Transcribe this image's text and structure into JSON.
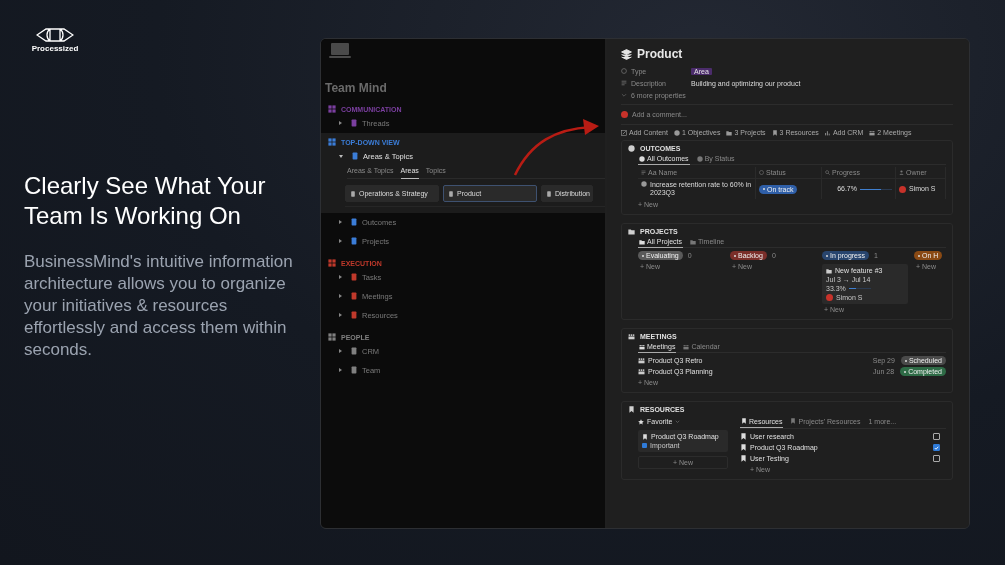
{
  "brand": {
    "name": "Processized"
  },
  "hero": {
    "heading": "Clearly See What Your Team Is Working On",
    "body": "BusinessMind's intuitive information architecture allows you to organize your initiatives & resources effortlessly and access them within seconds."
  },
  "sidebar": {
    "title": "Team Mind",
    "sections": [
      {
        "label": "COMMUNICATION",
        "color": "#7b3fa0",
        "highlighted": false,
        "items": [
          {
            "label": "Threads",
            "expanded": false,
            "highlighted": false
          }
        ]
      },
      {
        "label": "TOP-DOWN VIEW",
        "color": "#3b7dd8",
        "highlighted": true,
        "items": [
          {
            "label": "Areas & Topics",
            "expanded": true,
            "highlighted": true,
            "tabs": [
              {
                "label": "Areas & Topics",
                "selected": false
              },
              {
                "label": "Areas",
                "selected": true
              },
              {
                "label": "Topics",
                "selected": false
              }
            ],
            "cards": [
              {
                "label": "Operations & Strategy",
                "selected": false
              },
              {
                "label": "Product",
                "selected": true
              },
              {
                "label": "Distribution",
                "selected": false
              }
            ]
          },
          {
            "label": "Outcomes",
            "expanded": false,
            "highlighted": false
          },
          {
            "label": "Projects",
            "expanded": false,
            "highlighted": false
          }
        ]
      },
      {
        "label": "EXECUTION",
        "color": "#c0392b",
        "highlighted": false,
        "items": [
          {
            "label": "Tasks",
            "expanded": false,
            "highlighted": false
          },
          {
            "label": "Meetings",
            "expanded": false,
            "highlighted": false
          },
          {
            "label": "Resources",
            "expanded": false,
            "highlighted": false
          }
        ]
      },
      {
        "label": "PEOPLE",
        "color": "#808080",
        "highlighted": false,
        "items": [
          {
            "label": "CRM",
            "expanded": false,
            "highlighted": false
          },
          {
            "label": "Team",
            "expanded": false,
            "highlighted": false
          }
        ]
      }
    ]
  },
  "page": {
    "title": "Product",
    "properties": [
      {
        "label": "Type",
        "value": "Area",
        "kind": "tag"
      },
      {
        "label": "Description",
        "value": "Building and optimizing our product",
        "kind": "text"
      }
    ],
    "more_properties": "6 more properties",
    "comment_placeholder": "Add a comment...",
    "links": [
      "Add Content",
      "1 Objectives",
      "3 Projects",
      "3 Resources",
      "Add CRM",
      "2 Meetings"
    ],
    "outcomes": {
      "title": "OUTCOMES",
      "tabs": [
        {
          "label": "All Outcomes",
          "selected": true
        },
        {
          "label": "By Status",
          "selected": false
        }
      ],
      "columns": [
        "Aa Name",
        "Status",
        "Progress",
        "Owner"
      ],
      "rows": [
        {
          "name": "Increase retention rate to 60% in 2023Q3",
          "status": "On track",
          "color": "#2f5fa8",
          "progress": "66.7%",
          "level": 0.667,
          "owner": "Simon S"
        }
      ],
      "new": "+ New"
    },
    "projects": {
      "title": "PROJECTS",
      "tabs": [
        {
          "label": "All Projects",
          "selected": true
        },
        {
          "label": "Timeline",
          "selected": false
        }
      ],
      "columns": [
        {
          "label": "Evaluating",
          "color": "#5a5a5a",
          "count": "0",
          "new": "+ New"
        },
        {
          "label": "Backlog",
          "color": "#7a2e2a",
          "count": "0",
          "new": "+ New"
        },
        {
          "label": "In progress",
          "color": "#28456e",
          "count": "1",
          "cards": [
            {
              "title": "New feature #3",
              "dates": "Jul 3 → Jul 14",
              "progress": "33.3%",
              "level": 0.333,
              "owner": "Simon S"
            }
          ],
          "new": "+ New"
        },
        {
          "label": "On H",
          "color": "#8a4a14",
          "new": "+ New"
        }
      ]
    },
    "meetings": {
      "title": "MEETINGS",
      "tabs": [
        {
          "label": "Meetings",
          "selected": true
        },
        {
          "label": "Calendar",
          "selected": false
        }
      ],
      "rows": [
        {
          "title": "Product Q3 Retro",
          "date": "Sep 29",
          "status": "Scheduled",
          "color": "#4a4a4a"
        },
        {
          "title": "Product Q3 Planning",
          "date": "Jun 28",
          "status": "Completed",
          "color": "#2e6b46"
        }
      ],
      "new": "+ New"
    },
    "resources": {
      "title": "RESOURCES",
      "filter": "Favorite",
      "favorite": {
        "title": "Product Q3 Roadmap",
        "tag": "Important"
      },
      "favorite_new": "+ New",
      "tabs": [
        {
          "label": "Resources",
          "selected": true
        },
        {
          "label": "Projects' Resources",
          "selected": false
        },
        {
          "label": "1 more...",
          "selected": false
        }
      ],
      "rows": [
        {
          "title": "User research",
          "checked": false
        },
        {
          "title": "Product Q3 Roadmap",
          "checked": true
        },
        {
          "title": "User Testing",
          "checked": false
        }
      ],
      "new": "+ New"
    }
  }
}
